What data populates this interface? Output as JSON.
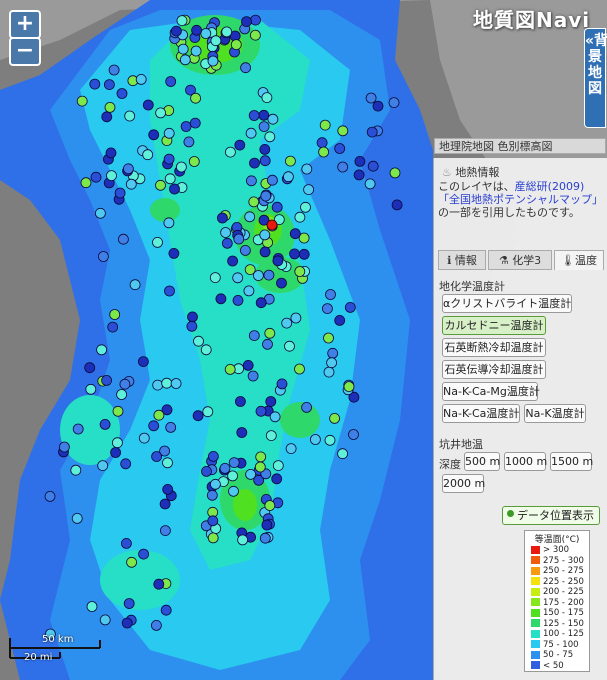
{
  "brand": "地質図Navi",
  "background_tab": "«背景地図",
  "zoom": {
    "in": "+",
    "out": "−"
  },
  "layer_label": "地理院地図 色別標高図",
  "info": {
    "title": "地熱情報",
    "text_1": "このレイヤは、",
    "link_1": "産総研(2009)「全国地熱ポテンシャルマップ」",
    "text_2": "の一部を引用したものです。"
  },
  "tabs": [
    {
      "icon": "info-icon",
      "label": "情報"
    },
    {
      "icon": "flask-icon",
      "label": "化学3"
    },
    {
      "icon": "thermometer-icon",
      "label": "温度"
    }
  ],
  "geochem": {
    "heading": "地化学温度計",
    "buttons": [
      "αクリストバライト温度計",
      "カルセドニー温度計",
      "石英断熱冷却温度計",
      "石英伝導冷却温度計",
      "Na-K-Ca-Mg温度計",
      "Na-K-Ca温度計",
      "Na-K温度計"
    ],
    "selected": "カルセドニー温度計"
  },
  "well": {
    "heading": "坑井地温",
    "depth_label": "深度",
    "depths": [
      "500 m",
      "1000 m",
      "1500 m",
      "2000 m"
    ]
  },
  "data_position_button": "データ位置表示",
  "legend": {
    "title": "等温面(°C)",
    "items": [
      {
        "label": "> 300",
        "color": "#e8190f"
      },
      {
        "label": "275 - 300",
        "color": "#f25a0c"
      },
      {
        "label": "250 - 275",
        "color": "#f89a0d"
      },
      {
        "label": "225 - 250",
        "color": "#f5e10b"
      },
      {
        "label": "200 - 225",
        "color": "#c6ee12"
      },
      {
        "label": "175 - 200",
        "color": "#86e81c"
      },
      {
        "label": "150 - 175",
        "color": "#4fe021"
      },
      {
        "label": "125 - 150",
        "color": "#2fd86a"
      },
      {
        "label": "100 - 125",
        "color": "#27dfc6"
      },
      {
        "label": "75 - 100",
        "color": "#29c9f0"
      },
      {
        "label": "50 - 75",
        "color": "#2e90ee"
      },
      {
        "label": "< 50",
        "color": "#2f5fe0"
      }
    ]
  },
  "scale": {
    "km": "50 km",
    "mi": "20 mi"
  }
}
